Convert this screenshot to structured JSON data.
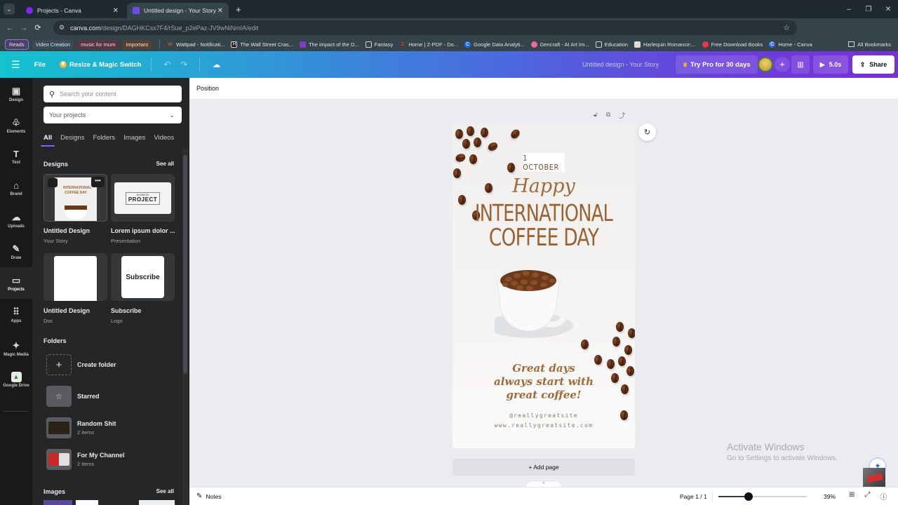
{
  "browser": {
    "tabs": [
      {
        "title": "Projects - Canva",
        "active": false,
        "favicon_color": "#7d2ae8"
      },
      {
        "title": "Untitled design - Your Story",
        "active": true,
        "favicon_color": "#6b4de6"
      }
    ],
    "new_tab_icon": "+",
    "window_controls": {
      "minimize": "–",
      "restore": "❐",
      "close": "✕"
    },
    "url_host": "canva.com",
    "url_path": "/design/DAGHKCsx7F4/rSue_p2ePaz-JV9wNiNmIA/edit",
    "nav": {
      "back": "←",
      "forward": "→",
      "reload": "⟳"
    },
    "extensions": [
      "ABP",
      "puzzle",
      "history",
      "profile",
      "menu"
    ],
    "bookmarks": [
      {
        "label": "Reads",
        "type": "chip",
        "color": "#4b3f6b"
      },
      {
        "label": "Video Creation",
        "type": "chip",
        "color": "#3a4a57"
      },
      {
        "label": "music for mum",
        "type": "chip",
        "color": "#5b3444"
      },
      {
        "label": "Important",
        "type": "chip",
        "color": "#5a4030"
      },
      {
        "label": "Wattpad - Notificati...",
        "icon_color": "#f05a28",
        "icon": "W"
      },
      {
        "label": "The Wall Street Cras...",
        "icon_color": "#111",
        "icon": "H"
      },
      {
        "label": "The impact of the D...",
        "icon_color": "#7b3fc4",
        "icon": "▮"
      },
      {
        "label": "Fantasy",
        "icon": "folder"
      },
      {
        "label": "Home | Z-PDF - Do...",
        "icon_color": "#d32f2f",
        "icon": "Z"
      },
      {
        "label": "Google Data Analyti...",
        "icon_color": "#1a73e8",
        "icon": "C"
      },
      {
        "label": "Gencraft - AI Art Im...",
        "icon_color": "#e86aa0",
        "icon": "●"
      },
      {
        "label": "Education",
        "icon": "folder"
      },
      {
        "label": "Harlequin Romance:...",
        "icon_color": "#ddd",
        "icon": "▤"
      },
      {
        "label": "Free Download Books",
        "icon_color": "#e53950",
        "icon": "♦"
      },
      {
        "label": "Home - Canva",
        "icon_color": "#00c4cc",
        "icon": "C"
      }
    ],
    "all_bookmarks": "All Bookmarks"
  },
  "topbar": {
    "menu_icon": "☰",
    "file": "File",
    "resize": "Resize & Magic Switch",
    "undo_icon": "↶",
    "redo_icon": "↷",
    "cloud_icon": "☁",
    "doc_title": "Untitled design - Your Story",
    "try_pro": "Try Pro for 30 days",
    "plus": "+",
    "stats_icon": "▥",
    "play_label": "5.0s",
    "share_label": "Share"
  },
  "rail": [
    {
      "label": "Design",
      "icon": "▣"
    },
    {
      "label": "Elements",
      "icon": "♧"
    },
    {
      "label": "Text",
      "icon": "T"
    },
    {
      "label": "Brand",
      "icon": "⌂"
    },
    {
      "label": "Uploads",
      "icon": "☁"
    },
    {
      "label": "Draw",
      "icon": "✎"
    },
    {
      "label": "Projects",
      "icon": "▭",
      "active": true
    },
    {
      "label": "Apps",
      "icon": "⠿"
    },
    {
      "label": "Magic Media",
      "icon": "✦"
    },
    {
      "label": "Google Drive",
      "icon": "▲"
    }
  ],
  "panel": {
    "search_placeholder": "Search your content",
    "filter_value": "Your projects",
    "tabs": [
      "All",
      "Designs",
      "Folders",
      "Images",
      "Videos"
    ],
    "active_tab": "All",
    "designs_heading": "Designs",
    "see_all": "See all",
    "designs": [
      {
        "title": "Untitled Design",
        "subtitle": "Your Story"
      },
      {
        "title": "Lorem ipsum dolor ...",
        "subtitle": "Presentation",
        "thumb_text_1": "BUSINESS",
        "thumb_text_2": "PROJECT"
      },
      {
        "title": "Untitled Design",
        "subtitle": "Doc"
      },
      {
        "title": "Subscribe",
        "subtitle": "Logo",
        "thumb_text": "Subscribe"
      }
    ],
    "more_icon": "•••",
    "folders_heading": "Folders",
    "folders": [
      {
        "name": "Create folder",
        "count": ""
      },
      {
        "name": "Starred",
        "count": ""
      },
      {
        "name": "Random Shit",
        "count": "2 items"
      },
      {
        "name": "For My Channel",
        "count": "2 items"
      }
    ],
    "images_heading": "Images"
  },
  "editor": {
    "context_label": "Position",
    "page_tools": [
      "lock",
      "duplicate",
      "add-page"
    ],
    "design": {
      "date": "1 OCTOBER",
      "happy": "Happy",
      "line1": "INTERNATIONAL",
      "line2": "COFFEE DAY",
      "tagline": [
        "Great days",
        "always start with",
        "great coffee!"
      ],
      "handle": "@reallygreatsite",
      "url": "www.reallygreatsite.com"
    },
    "add_page": "+ Add page",
    "watermark_title": "Activate Windows",
    "watermark_sub": "Go to Settings to activate Windows."
  },
  "footer": {
    "notes": "Notes",
    "page_count": "Page 1 / 1",
    "zoom_percent": "39%",
    "zoom_value": 0.39,
    "zoom_slider_fraction": 0.34
  }
}
